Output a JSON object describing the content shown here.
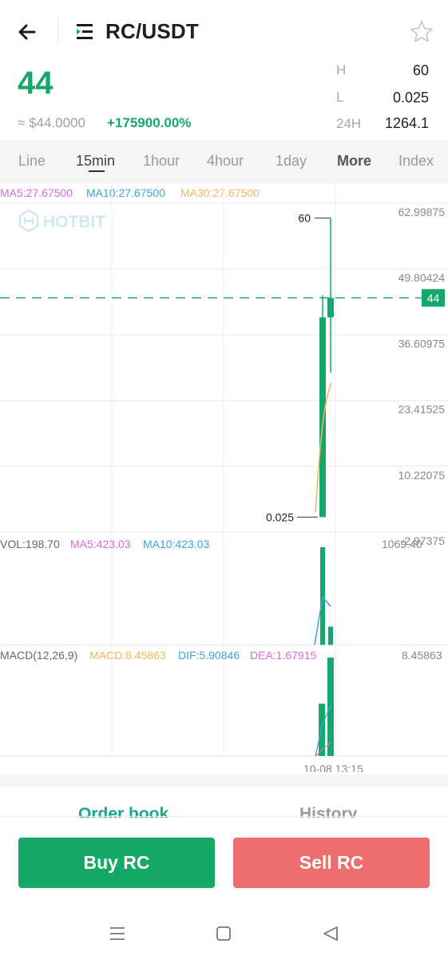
{
  "header": {
    "pair": "RC/USDT",
    "icons": {
      "back": "back-arrow-icon",
      "menu": "pair-menu-icon",
      "favorite": "star-icon"
    }
  },
  "ticker": {
    "price": "44",
    "usd_price": "≈ $44.0000",
    "change": "+175900.00%",
    "high_label": "H",
    "high": "60",
    "low_label": "L",
    "low": "0.025",
    "vol_label": "24H",
    "vol": "1264.1"
  },
  "tabs": [
    "Line",
    "15min",
    "1hour",
    "4hour",
    "1day",
    "More",
    "Index"
  ],
  "colors": {
    "up": "#16a86a",
    "down": "#ec6e6e",
    "ma5": "#d36bd3",
    "ma10": "#3aa7d2",
    "ma30": "#f0b75e"
  },
  "indicators": {
    "ma5": "MA5:27.67500",
    "ma10": "MA10:27.67500",
    "ma30": "MA30:27.67500",
    "vol": "VOL:198.70",
    "vol_ma5": "MA5:423.03",
    "vol_ma10": "MA10:423.03",
    "macd_label": "MACD(12,26,9)",
    "macd": "MACD:8.45863",
    "dif": "DIF:5.90846",
    "dea": "DEA:1.67915"
  },
  "chart_data": {
    "type": "candlestick",
    "watermark": "HOTBIT",
    "y_ticks": [
      "62.99875",
      "49.80424",
      "36.60975",
      "23.41525",
      "10.22075",
      "-2.97375"
    ],
    "y_range": [
      -2.97375,
      62.99875
    ],
    "candles": [
      {
        "open": 0.025,
        "high": 44.5,
        "low": 0.025,
        "close": 40.1
      },
      {
        "open": 40.1,
        "high": 60,
        "low": 29,
        "close": 44
      }
    ],
    "current_price": 44,
    "high_marker": "60",
    "low_marker": "0.025",
    "volume_max_label": "1069.40",
    "volume": [
      1069.4,
      198.7
    ],
    "volume_ma": [
      500,
      620,
      520
    ],
    "macd_max_label": "8.45863",
    "macd_hist": [
      4.5,
      8.45863
    ],
    "time_label": "10-08 13:15"
  },
  "bottom_tabs": {
    "order_book": "Order book",
    "history": "History"
  },
  "actions": {
    "buy": "Buy RC",
    "sell": "Sell RC"
  },
  "system_nav": {
    "icons": [
      "recents-icon",
      "home-icon",
      "back-icon"
    ]
  }
}
